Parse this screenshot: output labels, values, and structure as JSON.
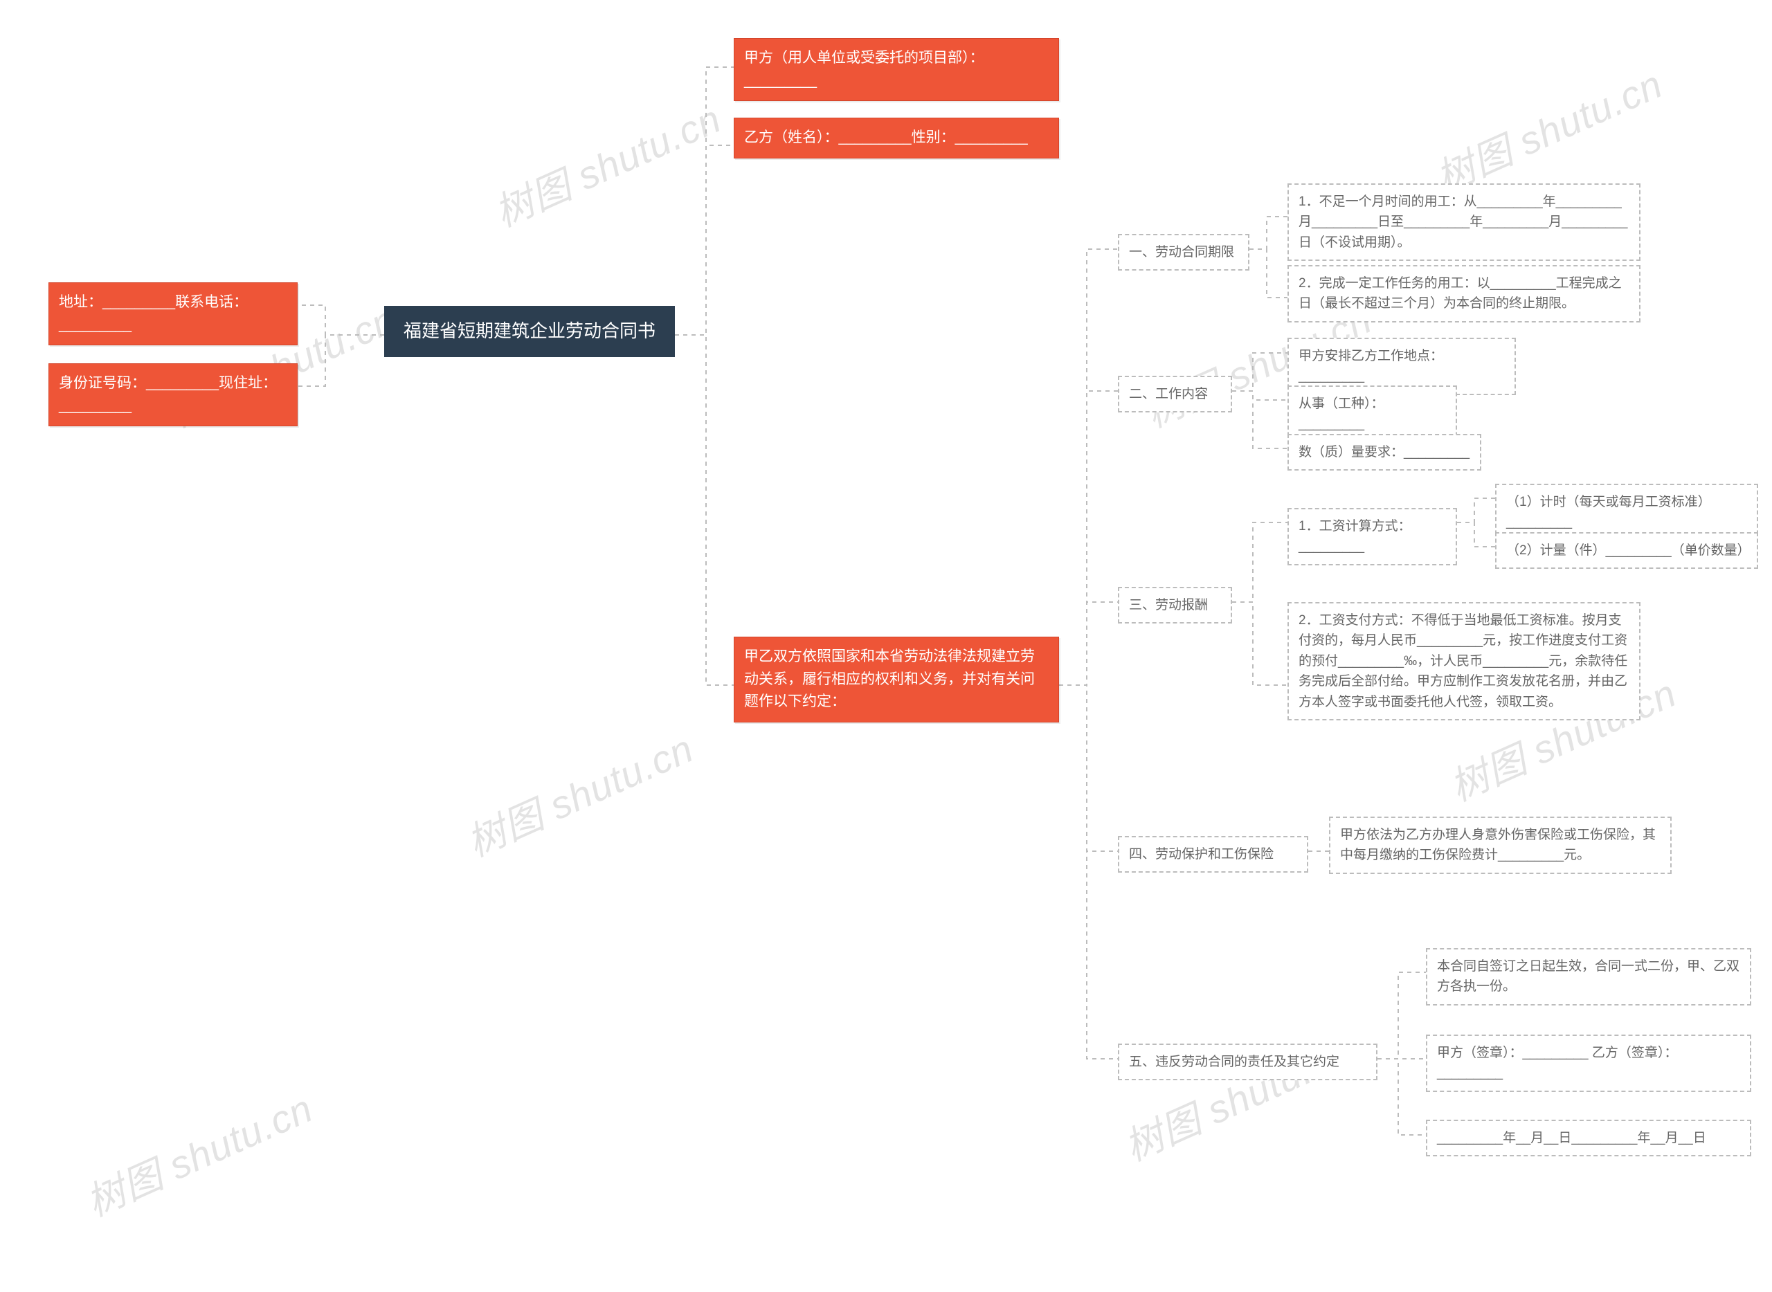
{
  "watermark": "树图 shutu.cn",
  "center": {
    "title": "福建省短期建筑企业劳动合同书"
  },
  "left": {
    "address": "地址：_________联系电话：_________",
    "idcard": "身份证号码：_________现住址：_________"
  },
  "right": {
    "partyA": "甲方（用人单位或受委托的项目部）：_________",
    "partyB": "乙方（姓名）：_________性别：_________",
    "agreement": "甲乙双方依照国家和本省劳动法律法规建立劳动关系，履行相应的权利和义务，并对有关问题作以下约定：",
    "sections": [
      {
        "label": "一、劳动合同期限",
        "children": [
          {
            "text": "1．不足一个月时间的用工：从_________年_________月_________日至_________年_________月_________日（不设试用期）。"
          },
          {
            "text": "2．完成一定工作任务的用工：以_________工程完成之日（最长不超过三个月）为本合同的终止期限。"
          }
        ]
      },
      {
        "label": "二、工作内容",
        "children": [
          {
            "text": "甲方安排乙方工作地点：_________"
          },
          {
            "text": "从事（工种）：_________"
          },
          {
            "text": "数（质）量要求：_________"
          }
        ]
      },
      {
        "label": "三、劳动报酬",
        "children": [
          {
            "text": "1．工资计算方式：_________",
            "children": [
              {
                "text": "（1）计时（每天或每月工资标准）_________"
              },
              {
                "text": "（2）计量（件）_________（单价数量）"
              }
            ]
          },
          {
            "text": "2．工资支付方式：不得低于当地最低工资标准。按月支付资的，每月人民币_________元，按工作进度支付工资的预付_________‰，计人民币_________元，余款待任务完成后全部付给。甲方应制作工资发放花名册，并由乙方本人签字或书面委托他人代签，领取工资。"
          }
        ]
      },
      {
        "label": "四、劳动保护和工伤保险",
        "children": [
          {
            "text": "甲方依法为乙方办理人身意外伤害保险或工伤保险，其中每月缴纳的工伤保险费计_________元。"
          }
        ]
      },
      {
        "label": "五、违反劳动合同的责任及其它约定",
        "children": [
          {
            "text": "本合同自签订之日起生效，合同一式二份，甲、乙双方各执一份。"
          },
          {
            "text": "甲方（签章）：_________ 乙方（签章）：_________"
          },
          {
            "text": "_________年__月__日_________年__月__日"
          }
        ]
      }
    ]
  }
}
